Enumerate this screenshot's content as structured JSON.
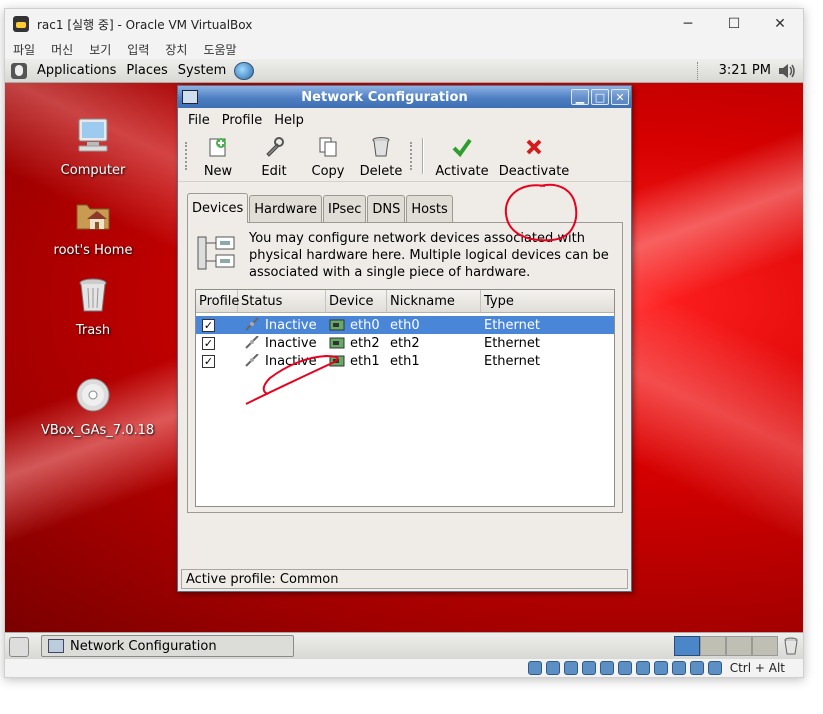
{
  "host_window": {
    "title": "rac1 [실행 중] - Oracle VM VirtualBox",
    "menu": [
      "파일",
      "머신",
      "보기",
      "입력",
      "장치",
      "도움말"
    ],
    "controls": {
      "minimize": "─",
      "maximize": "☐",
      "close": "✕"
    }
  },
  "guest_top_panel": {
    "menus": [
      "Applications",
      "Places",
      "System"
    ],
    "clock": "3:21 PM"
  },
  "desktop_icons": [
    {
      "label": "Computer",
      "icon": "computer-icon"
    },
    {
      "label": "root's Home",
      "icon": "home-folder-icon"
    },
    {
      "label": "Trash",
      "icon": "trash-icon"
    },
    {
      "label": "VBox_GAs_7.0.18",
      "icon": "cd-icon"
    }
  ],
  "dialog": {
    "title": "Network Configuration",
    "title_controls": {
      "minimize": "▁",
      "maximize": "□",
      "close": "✕"
    },
    "menu": [
      "File",
      "Profile",
      "Help"
    ],
    "toolbar": [
      {
        "label": "New",
        "icon": "new-icon"
      },
      {
        "label": "Edit",
        "icon": "edit-icon"
      },
      {
        "label": "Copy",
        "icon": "copy-icon"
      },
      {
        "label": "Delete",
        "icon": "delete-icon"
      },
      {
        "label": "Activate",
        "icon": "activate-icon"
      },
      {
        "label": "Deactivate",
        "icon": "deactivate-icon"
      }
    ],
    "tabs": [
      "Devices",
      "Hardware",
      "IPsec",
      "DNS",
      "Hosts"
    ],
    "active_tab": "Devices",
    "description": "You may configure network devices associated with physical hardware here.  Multiple logical devices can be associated with a single piece of hardware.",
    "columns": [
      "Profile",
      "Status",
      "Device",
      "Nickname",
      "Type"
    ],
    "rows": [
      {
        "profile": "✓",
        "status": "Inactive",
        "device": "eth0",
        "nickname": "eth0",
        "type": "Ethernet",
        "selected": true
      },
      {
        "profile": "✓",
        "status": "Inactive",
        "device": "eth2",
        "nickname": "eth2",
        "type": "Ethernet",
        "selected": false
      },
      {
        "profile": "✓",
        "status": "Inactive",
        "device": "eth1",
        "nickname": "eth1",
        "type": "Ethernet",
        "selected": false
      }
    ],
    "status_bar": "Active profile: Common"
  },
  "guest_bottom_panel": {
    "task": "Network Configuration",
    "workspace_count": 4,
    "active_workspace": 1
  },
  "host_statusbar": {
    "host_key": "Ctrl + Alt"
  },
  "colors": {
    "desktop_red": "#d60000",
    "title_blue": "#4e7fc2",
    "selection_blue": "#4a86d8",
    "annotation_red": "#e8001c"
  }
}
